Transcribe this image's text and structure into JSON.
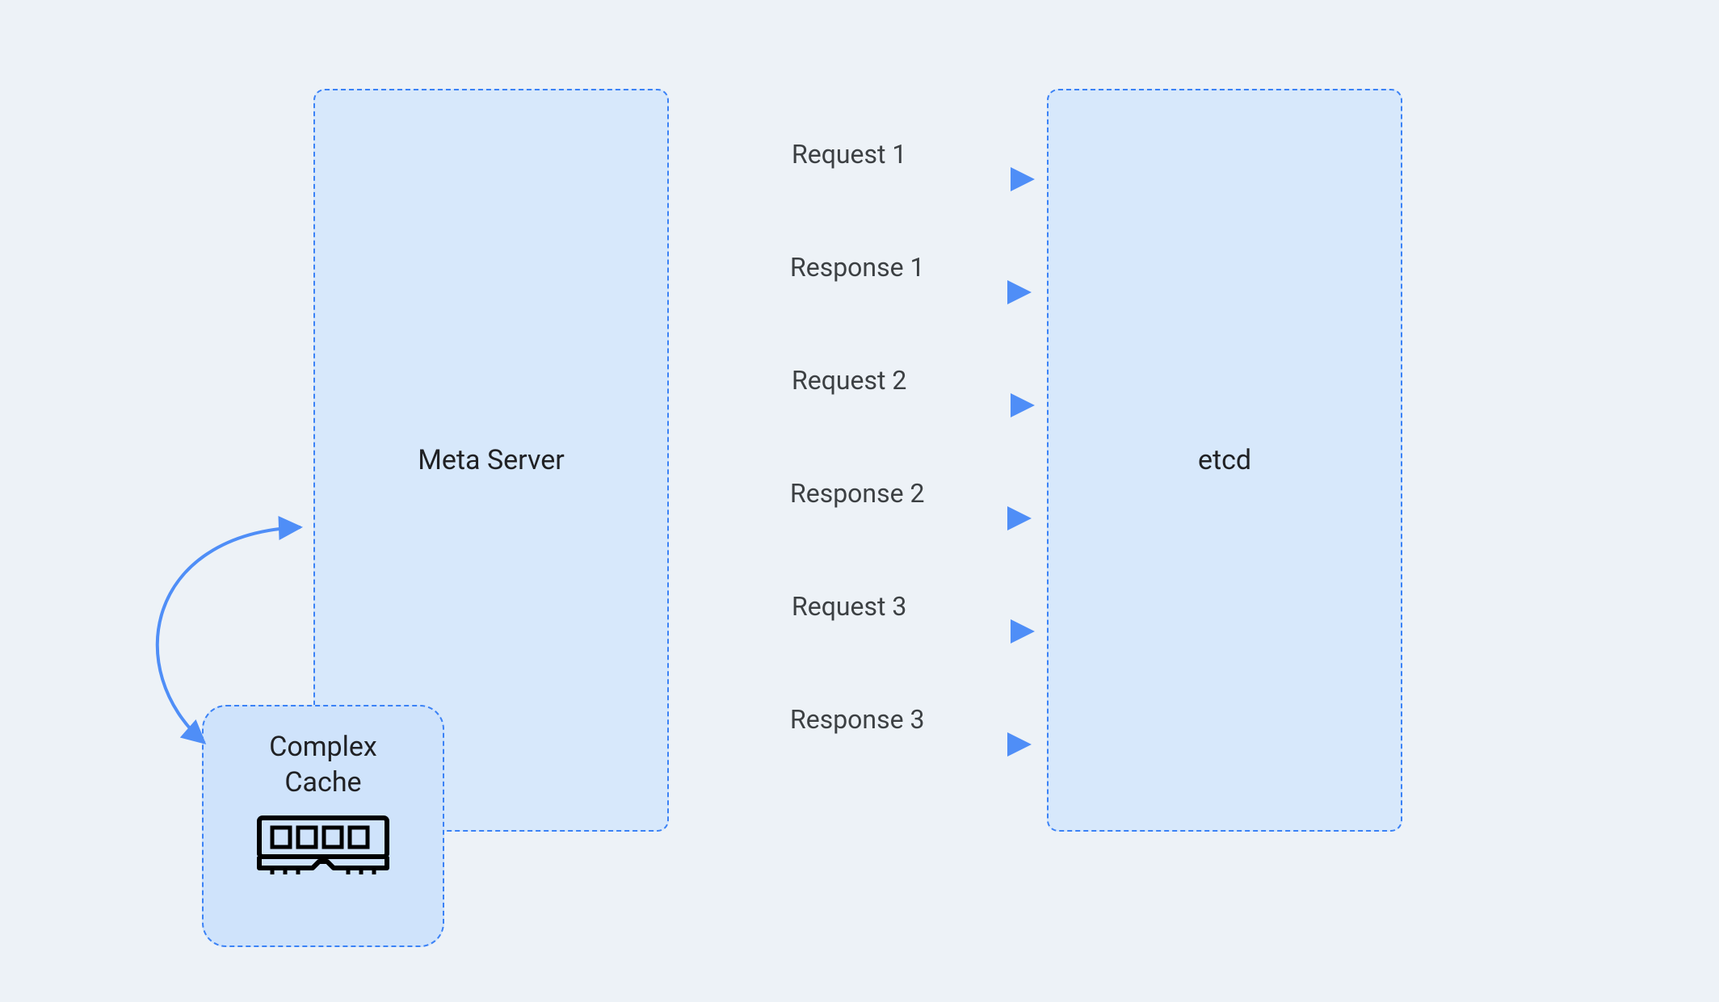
{
  "nodes": {
    "meta_server": {
      "label": "Meta Server"
    },
    "etcd": {
      "label": "etcd"
    },
    "cache": {
      "label_line1": "Complex",
      "label_line2": "Cache"
    }
  },
  "flows": [
    {
      "label": "Request 1",
      "direction": "right"
    },
    {
      "label": "Response 1",
      "direction": "left"
    },
    {
      "label": "Request 2",
      "direction": "right"
    },
    {
      "label": "Response 2",
      "direction": "left"
    },
    {
      "label": "Request 3",
      "direction": "right"
    },
    {
      "label": "Response 3",
      "direction": "left"
    }
  ]
}
